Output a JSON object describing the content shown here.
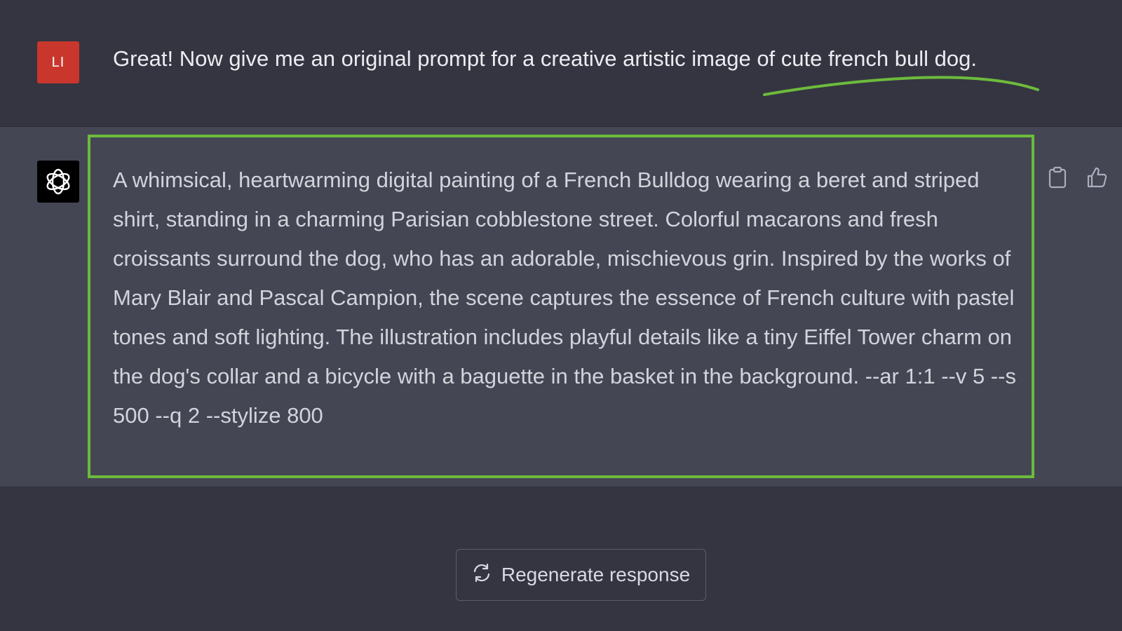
{
  "user_message": {
    "avatar_initials": "LI",
    "avatar_color": "#c9372c",
    "text": "Great! Now give me an original prompt for a creative artistic image of cute french bull dog."
  },
  "assistant_message": {
    "avatar_icon": "openai-logo-icon",
    "text": "A whimsical, heartwarming digital painting of a French Bulldog wearing a beret and striped shirt, standing in a charming Parisian cobblestone street. Colorful macarons and fresh croissants surround the dog, who has an adorable, mischievous grin. Inspired by the works of Mary Blair and Pascal Campion, the scene captures the essence of French culture with pastel tones and soft lighting. The illustration includes playful details like a tiny Eiffel Tower charm on the dog's collar and a bicycle with a baguette in the basket in the background. --ar 1:1 --v 5 --s 500 --q 2 --stylize 800",
    "actions": [
      {
        "name": "copy-icon"
      },
      {
        "name": "thumbs-up-icon"
      }
    ]
  },
  "annotation": {
    "color": "#6dbb3c"
  },
  "regenerate": {
    "label": "Regenerate response",
    "icon": "refresh-icon"
  }
}
